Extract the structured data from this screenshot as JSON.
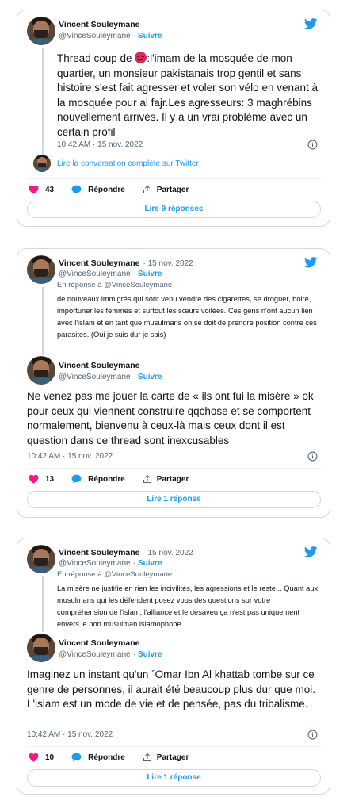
{
  "colors": {
    "accent": "#1d9bf0",
    "heart": "#f91880",
    "border": "#cfd9de",
    "text": "#0f1419",
    "muted": "#536471"
  },
  "tweet1": {
    "author": "Vincent Souleymane",
    "handle": "@VinceSouleymane",
    "follow": "Suivre",
    "text_before": "Thread coup de ",
    "emoji": "😡",
    "text_after": ":l'imam de la mosquée de mon quartier, un monsieur pakistanais trop gentil et sans histoire,s'est fait agresser et voler son vélo en venant à la mosquée pour al fajr.Les agresseurs: 3 maghrébins nouvellement arrivés. Il y a un vrai problème avec un certain profil",
    "time": "10:42 AM · 15 nov. 2022",
    "conversation_link": "Lire la conversation complète sur Twitter",
    "likes": "43",
    "reply_label": "Répondre",
    "share_label": "Partager",
    "read_button": "Lire 9 réponses"
  },
  "tweet2": {
    "parent": {
      "author": "Vincent Souleymane",
      "date": "· 15 nov. 2022",
      "handle": "@VinceSouleymane",
      "follow": "Suivre",
      "reply_to": "En réponse à @VinceSouleymane",
      "text": "de nouveaux immigrés qui sont venu vendre des cigarettes, se droguer, boire, importuner les femmes et surtout les sœurs voilées. Ces gens n'ont aucun lien avec l'islam et en tant que musulmans on se doit de prendre position contre ces parasites. (Oui je suis dur je sais)"
    },
    "main": {
      "author": "Vincent Souleymane",
      "handle": "@VinceSouleymane",
      "follow": "Suivre",
      "text": "Ne venez pas me jouer la carte de « ils ont fui la misère » ok pour ceux qui viennent construire qqchose et se comportent normalement, bienvenu à ceux-là mais ceux dont il est question dans ce thread sont inexcusables",
      "time": "10:42 AM · 15 nov. 2022",
      "likes": "13",
      "reply_label": "Répondre",
      "share_label": "Partager",
      "read_button": "Lire 1 réponse"
    }
  },
  "tweet3": {
    "parent": {
      "author": "Vincent Souleymane",
      "date": "· 15 nov. 2022",
      "handle": "@VinceSouleymane",
      "follow": "Suivre",
      "reply_to": "En réponse à @VinceSouleymane",
      "text": "La misère ne justifie en rien les incivilités, les agressions et le reste... Quant aux musulmans qui les défendent posez vous des questions sur votre compréhension de l'islam, l'alliance et le désaveu ça n'est pas uniquement envers le non musulman islamophobe"
    },
    "main": {
      "author": "Vincent Souleymane",
      "handle": "@VinceSouleymane",
      "follow": "Suivre",
      "text": "Imaginez un instant qu'un ´Omar Ibn Al khattab tombe sur ce genre de personnes, il aurait été beaucoup plus dur que moi. L'islam est un mode de vie et de pensée, pas du tribalisme.",
      "time": "10:42 AM · 15 nov. 2022",
      "likes": "10",
      "reply_label": "Répondre",
      "share_label": "Partager",
      "read_button": "Lire 1 réponse"
    }
  },
  "icons": {
    "logo": "twitter-bird-icon",
    "info": "info-icon",
    "like": "heart-icon",
    "reply": "speech-bubble-icon",
    "share": "share-icon"
  }
}
